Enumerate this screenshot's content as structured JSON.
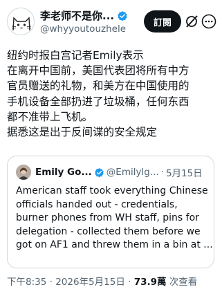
{
  "author": {
    "display_name": "李老师不是你...",
    "handle": "@whyyoutouzhele",
    "verified_icon": "verified-badge-icon"
  },
  "actions": {
    "subscribe_label": "訂閱",
    "grok_icon": "grok-slash-icon",
    "more_icon": "more-options-icon"
  },
  "post": {
    "lines": [
      "纽约时报白宫记者Emily表示",
      "在离开中国前，美国代表团将所有中方",
      "官员赠送的礼物，和美方在中国使用的",
      "手机设备全部扔进了垃圾桶，任何东西",
      "都不准带上飞机。",
      "据悉这是出于反间谍的安全规定"
    ]
  },
  "quote": {
    "display_name": "Emily Go...",
    "handle": "@Emilylg...",
    "separator": "·",
    "date": "5月15日",
    "lines": [
      "American staff took everything Chinese",
      "officials handed out - credentials,",
      "burner phones from WH staff, pins for",
      "delegation - collected them before we",
      "got on AF1 and threw them in a bin at ..."
    ]
  },
  "meta": {
    "time": "下午8:35",
    "sep1": " · ",
    "date": "2026年5月15日",
    "sep2": " · ",
    "views": "73.9萬",
    "views_label": " 次查看"
  },
  "colors": {
    "text": "#0f1419",
    "secondary": "#536471",
    "verified_blue": "#1d9bf0",
    "border": "#cfd9de"
  }
}
